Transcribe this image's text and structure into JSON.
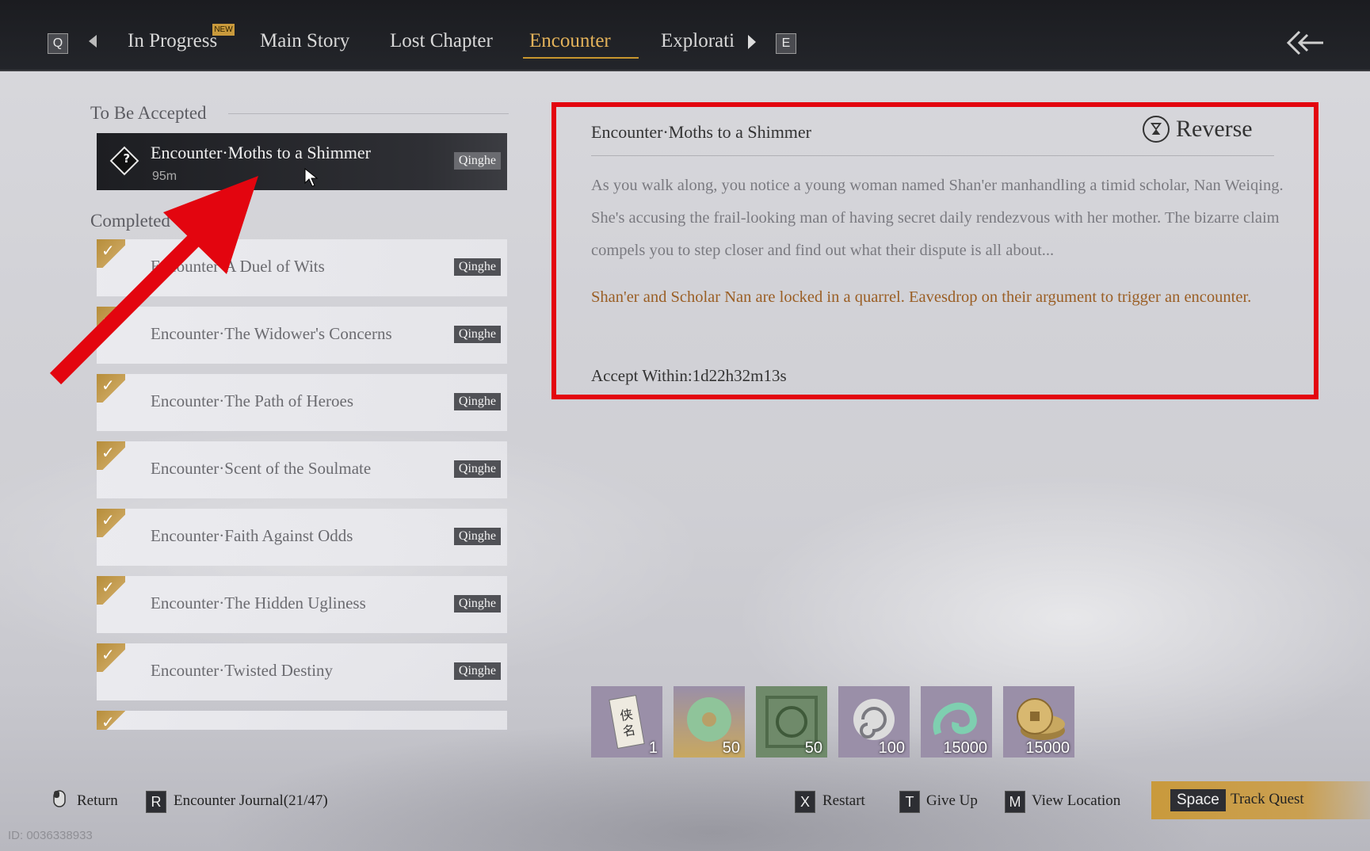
{
  "nav": {
    "left_key": "Q",
    "right_key": "E",
    "new_badge": "NEW",
    "tabs": [
      {
        "label": "In Progress"
      },
      {
        "label": "Main Story"
      },
      {
        "label": "Lost Chapter"
      },
      {
        "label": "Encounter"
      },
      {
        "label": "Explorati"
      }
    ],
    "active_tab": "Encounter"
  },
  "left_panel": {
    "to_be_accepted_label": "To Be Accepted",
    "completed_label": "Completed",
    "selected_quest": {
      "title": "Encounter·Moths to a Shimmer",
      "distance": "95m",
      "region": "Qinghe"
    },
    "completed_quests": [
      {
        "title": "Encounter·A Duel of Wits",
        "region": "Qinghe"
      },
      {
        "title": "Encounter·The Widower's Concerns",
        "region": "Qinghe"
      },
      {
        "title": "Encounter·The Path of Heroes",
        "region": "Qinghe"
      },
      {
        "title": "Encounter·Scent of the Soulmate",
        "region": "Qinghe"
      },
      {
        "title": "Encounter·Faith Against Odds",
        "region": "Qinghe"
      },
      {
        "title": "Encounter·The Hidden Ugliness",
        "region": "Qinghe"
      },
      {
        "title": "Encounter·Twisted Destiny",
        "region": "Qinghe"
      }
    ]
  },
  "detail": {
    "title": "Encounter·Moths to a Shimmer",
    "reverse_label": "Reverse",
    "description": "As you walk along, you notice a young woman named Shan'er manhandling a timid scholar, Nan Weiqing. She's accusing the frail-looking man of having secret daily rendezvous with her mother. The bizarre claim compels you to step closer and find out what their dispute is all about...",
    "objective": "Shan'er and Scholar Nan are locked in a quarrel. Eavesdrop on their argument to trigger an encounter.",
    "accept_within": "Accept Within:1d22h32m13s"
  },
  "rewards": [
    {
      "icon": "scroll-icon",
      "count": "1",
      "color": "#9a8fa8"
    },
    {
      "icon": "jade-disc-icon",
      "count": "50",
      "color": "#b8a068"
    },
    {
      "icon": "jade-token-icon",
      "count": "50",
      "color": "#6f8a6a"
    },
    {
      "icon": "swirl-icon",
      "count": "100",
      "color": "#9a8fa8"
    },
    {
      "icon": "wind-swirl-icon",
      "count": "15000",
      "color": "#9a8fa8"
    },
    {
      "icon": "coins-icon",
      "count": "15000",
      "color": "#9a8fa8"
    }
  ],
  "bottom_bar": {
    "return_label": "Return",
    "journal_key": "R",
    "journal_label": "Encounter Journal(21/47)",
    "restart_key": "X",
    "restart_label": "Restart",
    "giveup_key": "T",
    "giveup_label": "Give Up",
    "view_key": "M",
    "view_label": "View Location",
    "track_key": "Space",
    "track_label": "Track Quest"
  },
  "id_text": "ID: 0036338933",
  "colors": {
    "accent": "#e3b25a",
    "highlight_box": "#e3050f",
    "objective": "#9a5e24"
  }
}
